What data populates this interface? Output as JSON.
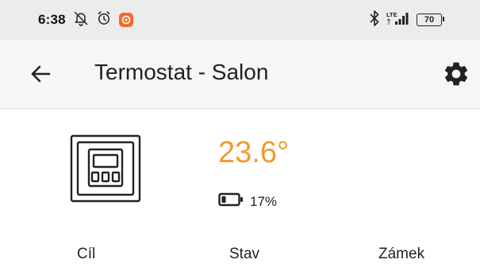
{
  "status_bar": {
    "time": "6:38",
    "icons": [
      "notifications-off-icon",
      "alarm-icon",
      "app-notification-icon",
      "bluetooth-icon",
      "lte-signal-icon",
      "battery-icon"
    ],
    "network_label": "LTE",
    "battery_percent": "70"
  },
  "app_bar": {
    "title": "Termostat - Salon",
    "back_icon": "arrow-left-icon",
    "settings_icon": "gear-icon"
  },
  "device": {
    "icon": "thermostat-device-icon",
    "temperature": "23.6°",
    "temperature_color": "#f29a2e",
    "battery_icon": "battery-low-icon",
    "battery_text": "17%",
    "battery_level": 0.17
  },
  "tabs": [
    {
      "label": "Cíl"
    },
    {
      "label": "Stav"
    },
    {
      "label": "Zámek"
    }
  ],
  "colors": {
    "status_bar_bg": "#ececec",
    "app_bar_bg": "#f6f6f6",
    "accent": "#f29a2e",
    "badge": "#f26a2e"
  }
}
